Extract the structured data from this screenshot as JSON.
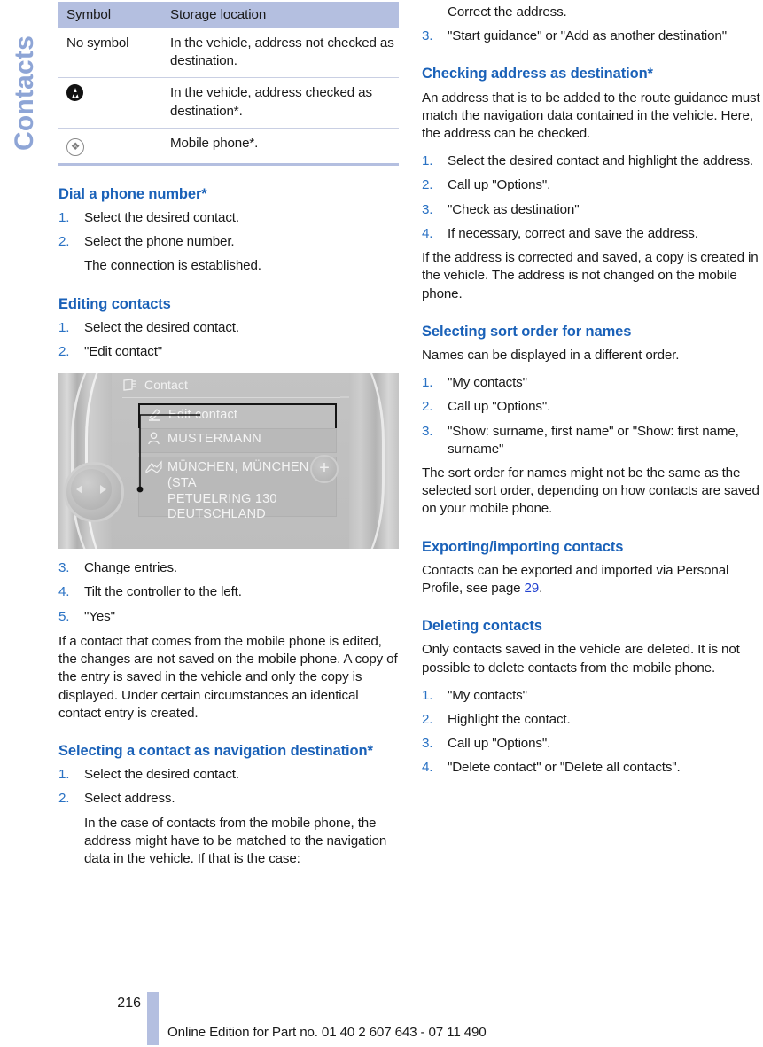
{
  "chapter_tab": "Contacts",
  "symbol_table": {
    "headers": [
      "Symbol",
      "Storage location"
    ],
    "rows": [
      {
        "symbol_text": "No symbol",
        "symbol_icon": "none",
        "location": "In the vehicle, address not checked as destination."
      },
      {
        "symbol_text": "",
        "symbol_icon": "destination-arrow-icon",
        "location": "In the vehicle, address checked as destination*."
      },
      {
        "symbol_text": "",
        "symbol_icon": "bluetooth-circle-icon",
        "location": "Mobile phone*."
      }
    ]
  },
  "left_column": {
    "dial_phone": {
      "heading": "Dial a phone number*",
      "steps": [
        {
          "num": "1.",
          "text": "Select the desired contact."
        },
        {
          "num": "2.",
          "text": "Select the phone number."
        },
        {
          "num": "",
          "text": "The connection is established."
        }
      ]
    },
    "editing_contacts": {
      "heading": "Editing contacts",
      "steps_before": [
        {
          "num": "1.",
          "text": "Select the desired contact."
        },
        {
          "num": "2.",
          "text": "\"Edit contact\""
        }
      ],
      "steps_after": [
        {
          "num": "3.",
          "text": "Change entries."
        },
        {
          "num": "4.",
          "text": "Tilt the controller to the left."
        },
        {
          "num": "5.",
          "text": "\"Yes\""
        }
      ],
      "note": "If a contact that comes from the mobile phone is edited, the changes are not saved on the mobile phone. A copy of the entry is saved in the vehicle and only the copy is displayed. Under certain circumstances an identical contact entry is created."
    },
    "idrive_figure": {
      "header_label": "Contact",
      "header_icon": "contact-card-icon",
      "rows": [
        {
          "icon": "pencil-edit-icon",
          "label": "Edit contact",
          "selected": true
        },
        {
          "icon": "person-icon",
          "label": "MUSTERMANN",
          "selected": false
        },
        {
          "icon": "map-flag-icon",
          "label": "MÜNCHEN, MÜNCHEN (STA\nPETUELRING 130\nDEUTSCHLAND",
          "selected": false
        }
      ],
      "controller_icon": "idrive-controller",
      "plus_button": "+"
    },
    "nav_destination": {
      "heading": "Selecting a contact as navigation destination*",
      "steps": [
        {
          "num": "1.",
          "text": "Select the desired contact."
        },
        {
          "num": "2.",
          "text": "Select address."
        },
        {
          "num": "",
          "text": "In the case of contacts from the mobile phone, the address might have to be matched to the navigation data in the vehicle. If that is the case:"
        }
      ]
    }
  },
  "right_column": {
    "continued_steps": [
      {
        "num": "",
        "text": "Correct the address."
      },
      {
        "num": "3.",
        "text": "\"Start guidance\" or \"Add as another destination\""
      }
    ],
    "checking_address": {
      "heading": "Checking address as destination*",
      "intro": "An address that is to be added to the route guidance must match the navigation data contained in the vehicle. Here, the address can be checked.",
      "steps": [
        {
          "num": "1.",
          "text": "Select the desired contact and highlight the address."
        },
        {
          "num": "2.",
          "text": "Call up \"Options\"."
        },
        {
          "num": "3.",
          "text": "\"Check as destination\""
        },
        {
          "num": "4.",
          "text": "If necessary, correct and save the address."
        }
      ],
      "note": "If the address is corrected and saved, a copy is created in the vehicle. The address is not changed on the mobile phone."
    },
    "sort_order": {
      "heading": "Selecting sort order for names",
      "intro": "Names can be displayed in a different order.",
      "steps": [
        {
          "num": "1.",
          "text": "\"My contacts\""
        },
        {
          "num": "2.",
          "text": "Call up \"Options\"."
        },
        {
          "num": "3.",
          "text": "\"Show: surname, first name\" or \"Show: first name, surname\""
        }
      ],
      "note": "The sort order for names might not be the same as the selected sort order, depending on how contacts are saved on your mobile phone."
    },
    "export_import": {
      "heading": "Exporting/importing contacts",
      "text_before": "Contacts can be exported and imported via Personal Profile, see page ",
      "page_ref": "29",
      "text_after": "."
    },
    "deleting": {
      "heading": "Deleting contacts",
      "intro": "Only contacts saved in the vehicle are deleted. It is not possible to delete contacts from the mobile phone.",
      "steps": [
        {
          "num": "1.",
          "text": "\"My contacts\""
        },
        {
          "num": "2.",
          "text": "Highlight the contact."
        },
        {
          "num": "3.",
          "text": "Call up \"Options\"."
        },
        {
          "num": "4.",
          "text": "\"Delete contact\" or \"Delete all contacts\"."
        }
      ]
    }
  },
  "footer": {
    "page_number": "216",
    "note": "Online Edition for Part no. 01 40 2 607 643 - 07 11 490"
  },
  "colors": {
    "heading_blue": "#1a61b8",
    "number_blue": "#2a72c4",
    "tab_blue": "#8ea5d6",
    "table_header_bg": "#b4bfe0",
    "link_blue": "#2040d0"
  }
}
